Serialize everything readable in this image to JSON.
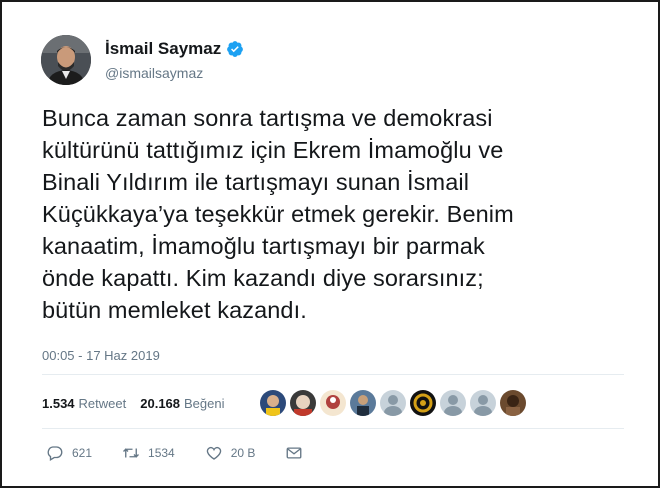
{
  "author": {
    "name": "İsmail Saymaz",
    "handle": "@ismailsaymaz",
    "verified_color": "#1da1f2"
  },
  "tweet": {
    "lines": [
      "Bunca zaman sonra tartışma ve demokrasi",
      "kültürünü tattığımız için Ekrem İmamoğlu ve",
      "Binali Yıldırım ile tartışmayı sunan İsmail",
      "Küçükkaya’ya teşekkür etmek gerekir. Benim",
      "kanaatim, İmamoğlu tartışmayı bir parmak",
      "önde kapattı. Kim kazandı diye sorarsınız;",
      "bütün memleket kazandı."
    ],
    "timestamp": "00:05 - 17 Haz 2019"
  },
  "stats": {
    "retweets_count": "1.534",
    "retweets_label": "Retweet",
    "likes_count": "20.168",
    "likes_label": "Beğeni"
  },
  "actions": {
    "reply_count": "621",
    "retweet_count": "1534",
    "like_count": "20 B"
  },
  "colors": {
    "text": "#14171a",
    "secondary": "#657786",
    "divider": "#e6ecf0"
  }
}
